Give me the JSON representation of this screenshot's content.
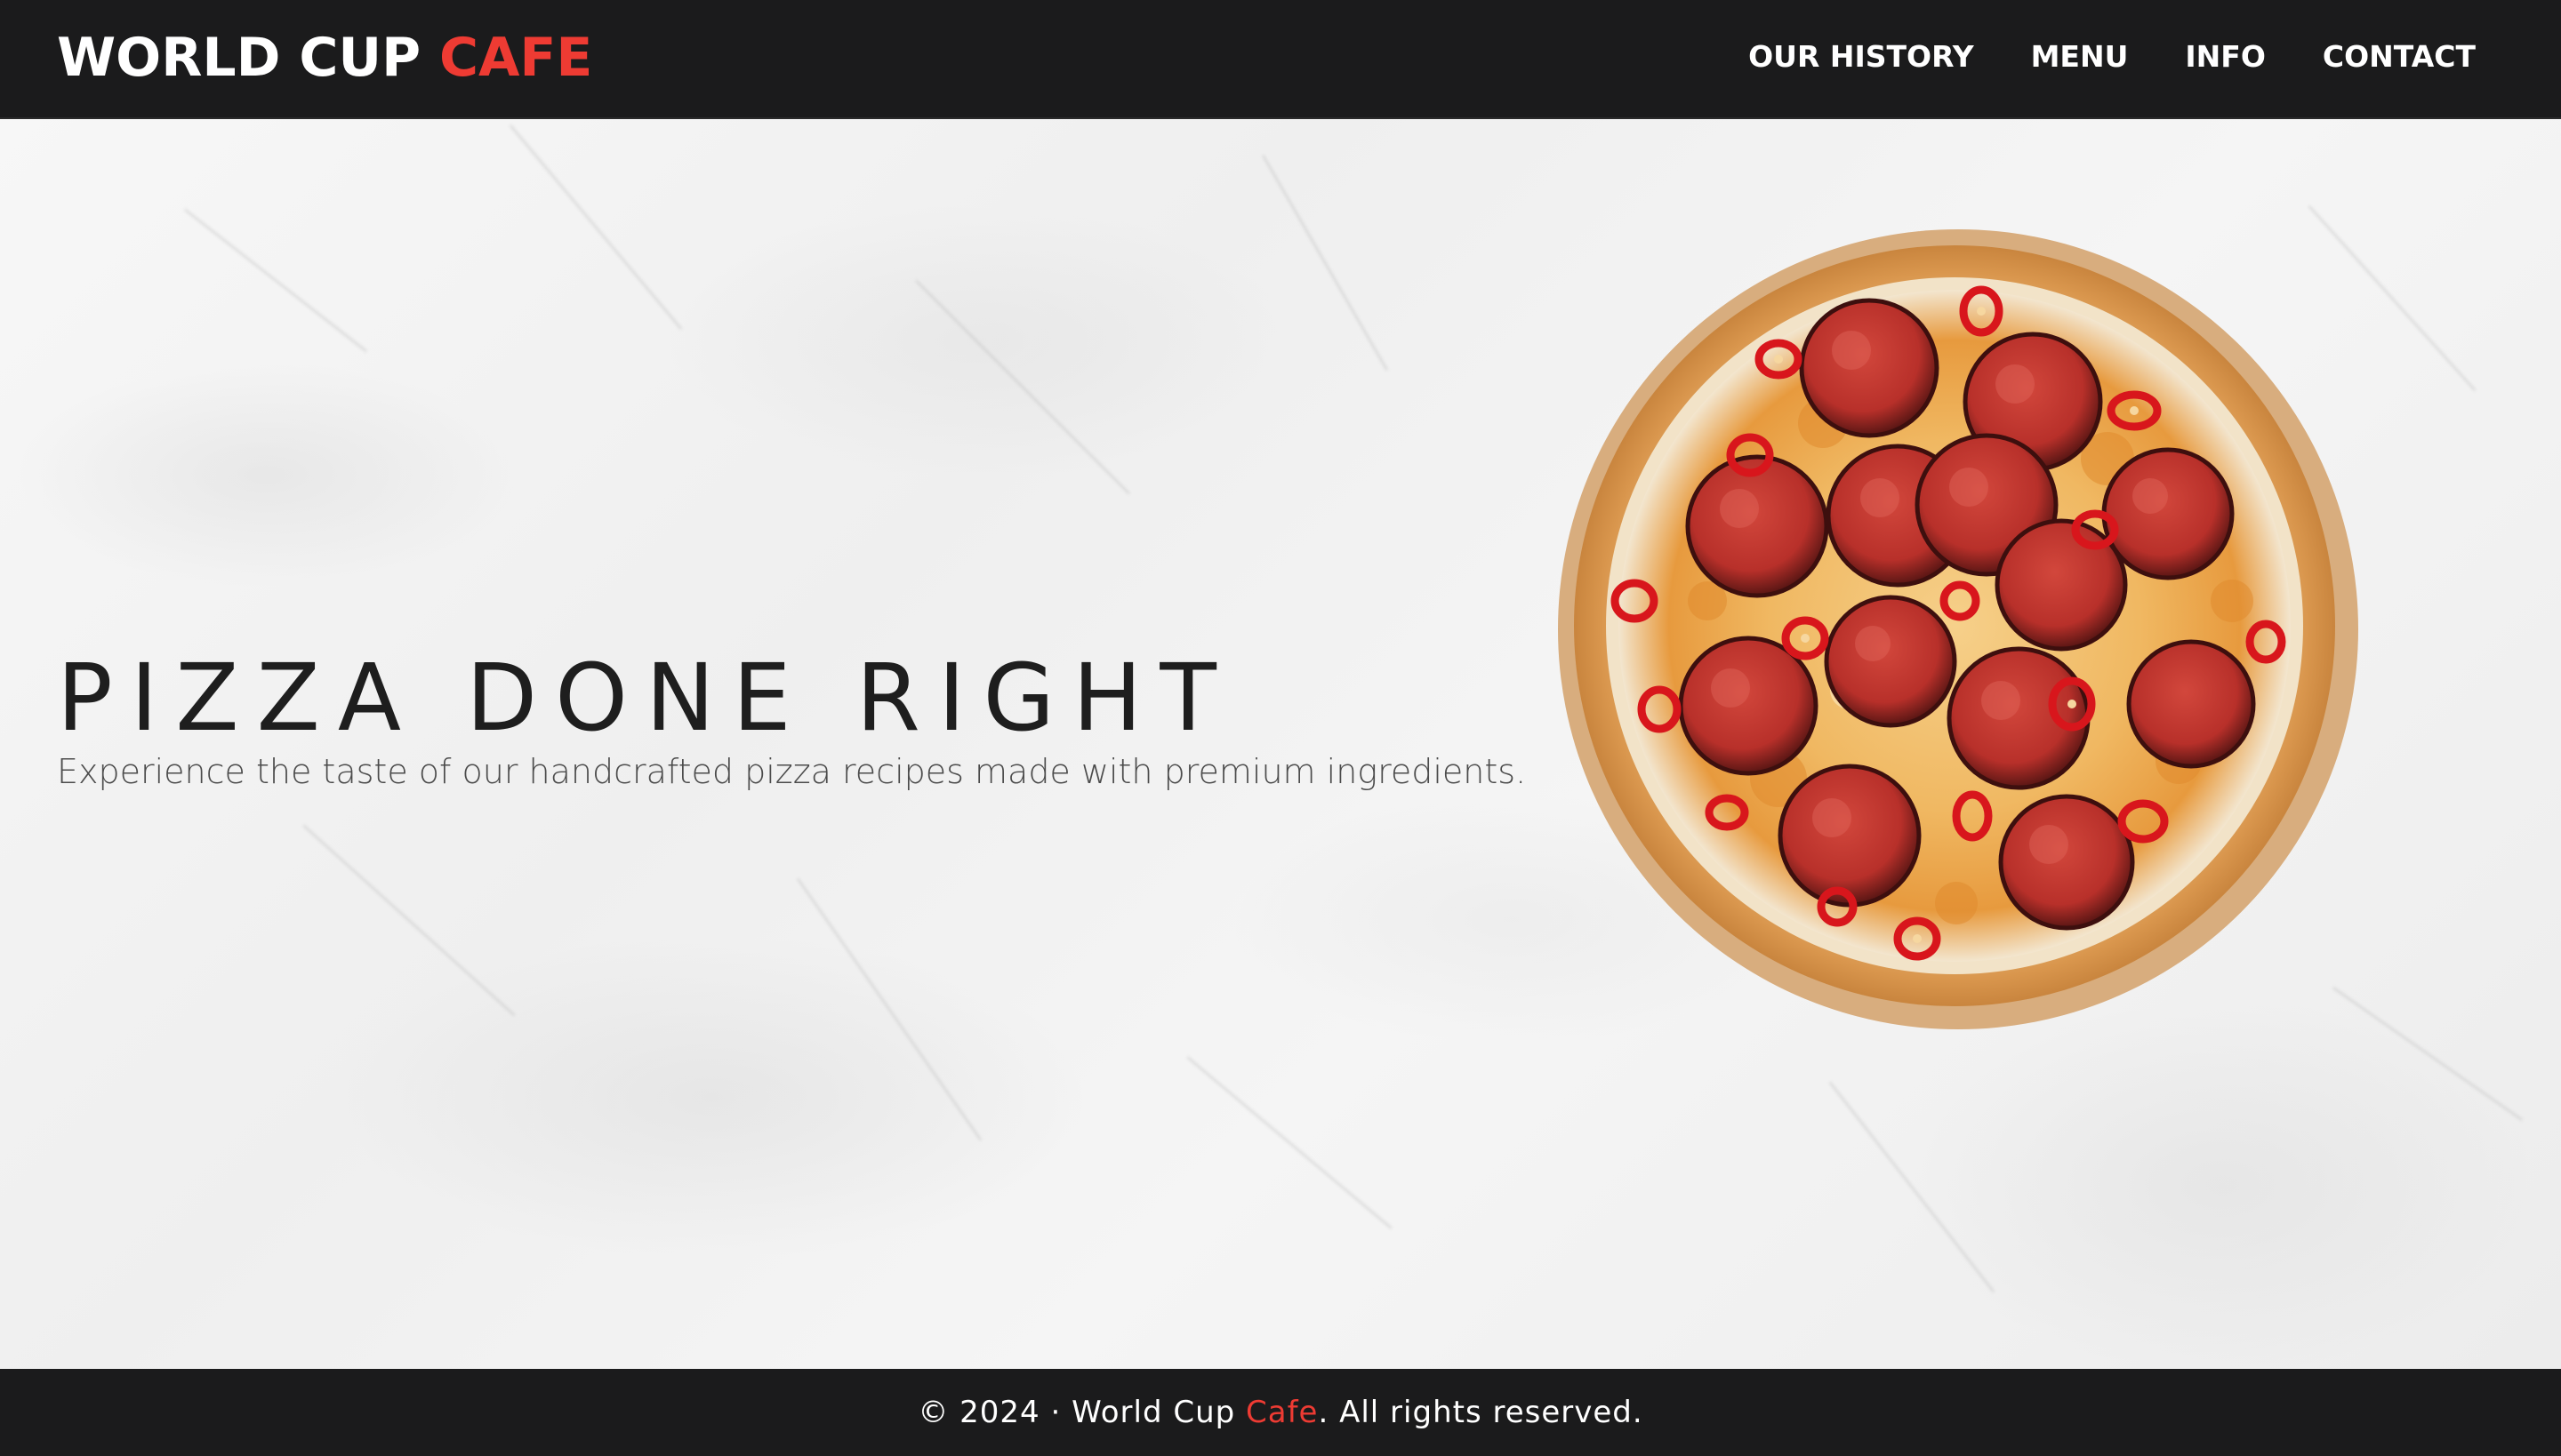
{
  "header": {
    "logo_main": "WORLD CUP",
    "logo_accent": "CAFE",
    "nav": [
      {
        "label": "OUR HISTORY"
      },
      {
        "label": "MENU"
      },
      {
        "label": "INFO"
      },
      {
        "label": "CONTACT"
      }
    ]
  },
  "hero": {
    "title": "PIZZA DONE RIGHT",
    "subtitle": "Experience the taste of our handcrafted pizza recipes made with premium ingredients.",
    "image_icon": "pepperoni-pizza-image"
  },
  "footer": {
    "prefix": "© 2024 · World Cup ",
    "accent": "Cafe",
    "suffix": ". All rights reserved."
  },
  "colors": {
    "bar_background": "#1b1b1c",
    "accent": "#ee3b33",
    "hero_background": "#f2f2f2",
    "title_text": "#1e1e1e"
  }
}
